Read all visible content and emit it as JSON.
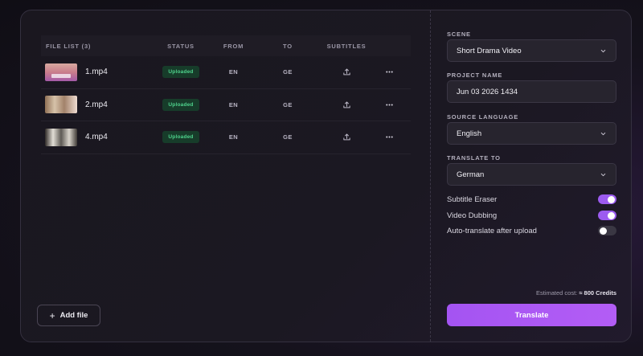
{
  "file_list": {
    "headers": {
      "file": "FILE LIST (3)",
      "status": "STATUS",
      "from": "FROM",
      "to": "TO",
      "subtitles": "SUBTITLES"
    },
    "rows": [
      {
        "name": "1.mp4",
        "status": "Uploaded",
        "from": "EN",
        "to": "GE"
      },
      {
        "name": "2.mp4",
        "status": "Uploaded",
        "from": "EN",
        "to": "GE"
      },
      {
        "name": "4.mp4",
        "status": "Uploaded",
        "from": "EN",
        "to": "GE"
      }
    ],
    "add_file_label": "Add file"
  },
  "settings": {
    "scene": {
      "label": "SCENE",
      "value": "Short Drama Video"
    },
    "project_name": {
      "label": "PROJECT NAME",
      "value": "Jun 03 2026 1434"
    },
    "source_language": {
      "label": "SOURCE LANGUAGE",
      "value": "English"
    },
    "translate_to": {
      "label": "TRANSLATE TO",
      "value": "German"
    },
    "toggles": [
      {
        "label": "Subtitle Eraser",
        "on": true
      },
      {
        "label": "Video Dubbing",
        "on": true
      },
      {
        "label": "Auto-translate after upload",
        "on": false
      }
    ],
    "cost_label": "Estimated cost:",
    "cost_value": "≈ 800 Credits",
    "translate_label": "Translate"
  },
  "colors": {
    "accent": "#a454f2",
    "badge_text": "#4fd48d",
    "badge_bg": "#173c2a"
  },
  "icons": [
    "upload-icon",
    "more-icon",
    "plus-icon",
    "chevron-down-icon"
  ]
}
